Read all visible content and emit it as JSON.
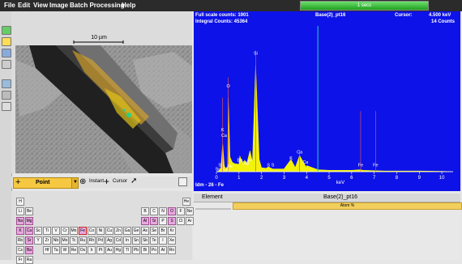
{
  "menu": [
    "File",
    "Edit",
    "View",
    "Image",
    "Batch Processing",
    "Help"
  ],
  "status": {
    "progress_text": "1 secs",
    "progress_fraction": 1.0
  },
  "image": {
    "scalebar_label": "10 µm"
  },
  "pointbar": {
    "point_label": "Point",
    "instant_label": "Instant",
    "cursor_label": "Cursor"
  },
  "spectrum": {
    "full_scale": "Full scale counts: 1901",
    "integral": "Integral Counts: 45364",
    "title": "Base(2)_pt16",
    "cursor": "Cursor:",
    "cursor_value": "4.500 keV",
    "counts": "14 Counts",
    "xunit": "keV",
    "bottom_label": "Idm - 26 - Fe",
    "xticks": [
      "0",
      "1",
      "2",
      "3",
      "4",
      "5",
      "6",
      "7",
      "8",
      "9",
      "10"
    ],
    "peak_labels": [
      "S",
      "K",
      "Ca",
      "O",
      "Si",
      "Ba",
      "Mg",
      "Al",
      "Fe",
      "S",
      "S",
      "K",
      "Ca",
      "Ca",
      "Fe",
      "Fe",
      "Ca",
      "Sr"
    ]
  },
  "results": {
    "col_element": "Element",
    "col_sample": "Base(2)_pt16",
    "unit": "Atom %"
  },
  "chart_data": {
    "type": "area",
    "title": "Base(2)_pt16",
    "xlabel": "keV",
    "ylabel": "",
    "xlim": [
      0,
      10.5
    ],
    "ylim": [
      0,
      1901
    ],
    "cursor_keV": 4.5,
    "series": [
      {
        "x": [
          0,
          0.1,
          0.2,
          0.277,
          0.35,
          0.4,
          0.5,
          0.525,
          0.6,
          0.7,
          0.8,
          1.0,
          1.04,
          1.2,
          1.25,
          1.35,
          1.487,
          1.6,
          1.74,
          1.9,
          2.0,
          2.2,
          2.31,
          2.5,
          3.0,
          3.31,
          3.5,
          3.69,
          4.0,
          4.01,
          4.5,
          5.0,
          5.5,
          6.0,
          6.4,
          6.5,
          7.06,
          7.5,
          8.0,
          9.0,
          10.0,
          10.5
        ],
        "values": [
          0,
          10,
          60,
          420,
          90,
          40,
          80,
          1100,
          220,
          140,
          120,
          110,
          230,
          110,
          170,
          120,
          310,
          140,
          1580,
          180,
          60,
          50,
          70,
          40,
          40,
          180,
          60,
          240,
          60,
          90,
          30,
          20,
          20,
          20,
          30,
          20,
          15,
          10,
          10,
          10,
          5,
          0
        ]
      }
    ]
  }
}
